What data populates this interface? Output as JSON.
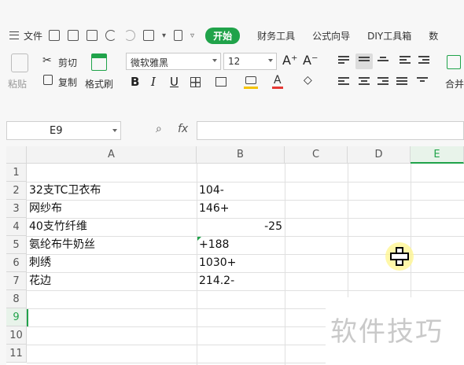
{
  "menu": {
    "file_label": "文件",
    "tabs": [
      "开始",
      "财务工具",
      "公式向导",
      "DIY工具箱",
      "数"
    ]
  },
  "ribbon": {
    "paste_label": "粘贴",
    "cut_label": "剪切",
    "copy_label": "复制",
    "format_painter_label": "格式刷",
    "font_name": "微软雅黑",
    "font_size": "12",
    "bold_label": "B",
    "italic_label": "I",
    "underline_label": "U",
    "merge_label": "合并",
    "font_color": "#e53935",
    "fill_color": "#f5c400"
  },
  "formula_bar": {
    "name_box": "E9",
    "fx_label": "fx"
  },
  "sheet": {
    "columns": [
      "A",
      "B",
      "C",
      "D",
      "E"
    ],
    "selected_column": "E",
    "rows": [
      "1",
      "2",
      "3",
      "4",
      "5",
      "6",
      "7",
      "8",
      "9",
      "10",
      "11"
    ],
    "selected_row": "9",
    "cells": [
      {
        "a": "",
        "b": ""
      },
      {
        "a": "32支TC卫衣布",
        "b": "104-"
      },
      {
        "a": "网纱布",
        "b": "146+"
      },
      {
        "a": "40支竹纤维",
        "b": "-25"
      },
      {
        "a": "氨纶布牛奶丝",
        "b": "+188"
      },
      {
        "a": "刺绣",
        "b": "1030+"
      },
      {
        "a": "花边",
        "b": "214.2-"
      }
    ]
  },
  "watermark": "软件技巧",
  "accent_color": "#20a34a"
}
